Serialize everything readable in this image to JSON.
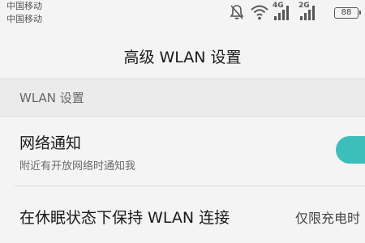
{
  "status_bar": {
    "carrier_1": "中国移动",
    "carrier_2": "中国移动",
    "network_1": "4G",
    "network_2": "2G",
    "battery": "88",
    "icons": [
      "mute-icon",
      "wifi-icon",
      "signal-icon",
      "signal-icon",
      "battery-icon"
    ]
  },
  "header": {
    "title": "高级 WLAN 设置"
  },
  "section": {
    "title": "WLAN 设置"
  },
  "settings": {
    "notify": {
      "title": "网络通知",
      "subtitle": "附近有开放网络时通知我",
      "enabled": true
    },
    "sleep": {
      "title": "在休眠状态下保持 WLAN 连接",
      "value": "仅限充电时"
    }
  },
  "colors": {
    "accent": "#3cbfbb",
    "background": "#f4f4f4",
    "section_background": "#ebebeb"
  }
}
